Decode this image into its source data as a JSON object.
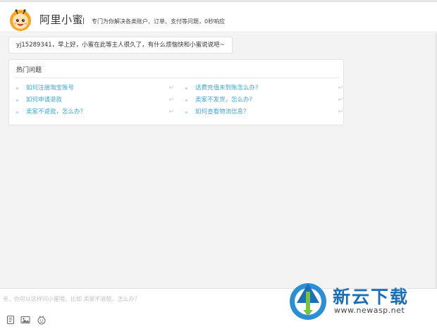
{
  "header": {
    "app_title": "阿里小蜜",
    "slogan": "专门为你解决各类账户、订单、支付等问题，0秒响应"
  },
  "chat": {
    "greeting": "yj15289341，早上好，小蜜在此等主人很久了，有什么烦恼快和小蜜说说吧~"
  },
  "hot_questions": {
    "title": "热门问题",
    "left": [
      "如何注册淘宝账号",
      "如何申请退款",
      "卖家不退款，怎么办？"
    ],
    "right": [
      "话费充值未到账怎么办？",
      "卖家不发货，怎么办？",
      "如何查看物流信息？"
    ]
  },
  "input": {
    "placeholder": "亲，你可以这样问小蜜哦，比如 卖家不退款，怎么办？"
  },
  "toolbar": {
    "icons": [
      "note-icon",
      "image-icon",
      "emoji-icon"
    ]
  },
  "watermark": {
    "title": "新云下载",
    "url": "www.newasp.net"
  },
  "colors": {
    "link": "#3fa6d4",
    "chat_bg": "#f3f3f3",
    "watermark_blue": "#1f6fb4"
  }
}
